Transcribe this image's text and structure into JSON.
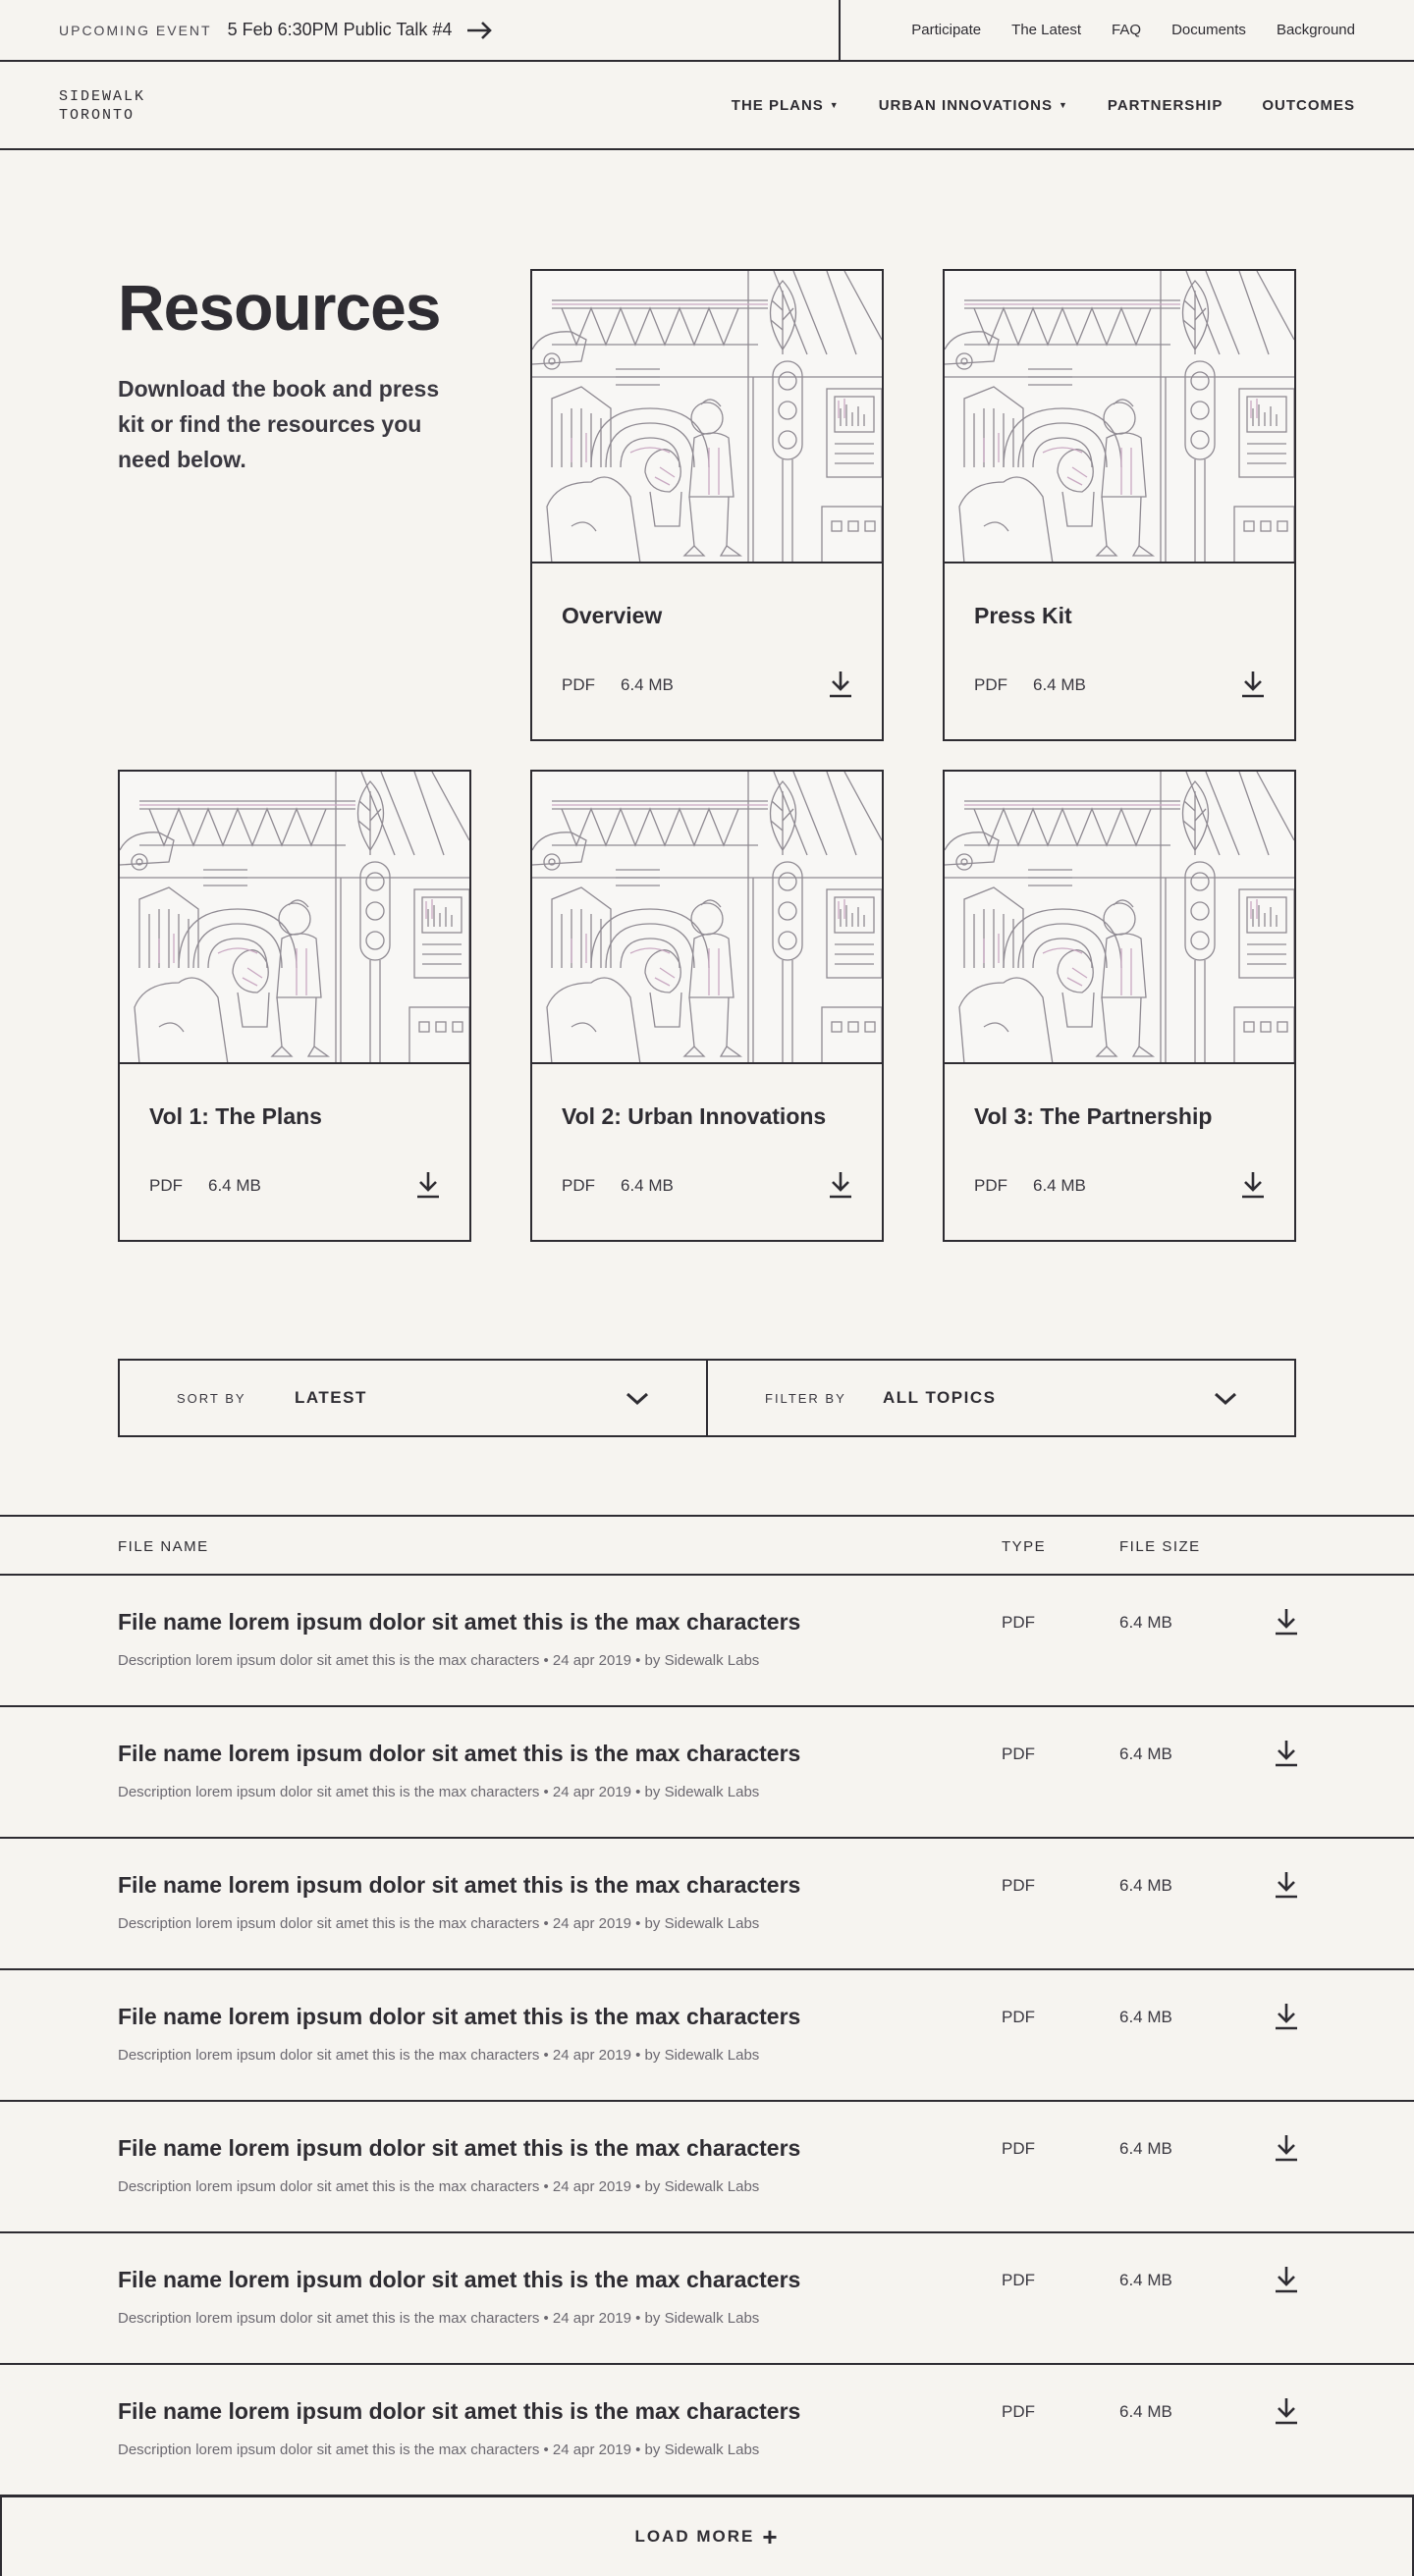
{
  "event_bar": {
    "kicker": "Upcoming Event",
    "title": "5 Feb 6:30PM Public Talk #4",
    "arrow_icon": "arrow-right-icon"
  },
  "utility_nav": [
    "Participate",
    "The Latest",
    "FAQ",
    "Documents",
    "Background"
  ],
  "logo": {
    "line1": "SIDEWALK",
    "line2": "TORONTO"
  },
  "main_nav": [
    {
      "label": "The Plans",
      "has_dropdown": true
    },
    {
      "label": "Urban Innovations",
      "has_dropdown": true
    },
    {
      "label": "Partnership",
      "has_dropdown": false
    },
    {
      "label": "Outcomes",
      "has_dropdown": false
    }
  ],
  "hero": {
    "title": "Resources",
    "subtitle": "Download the book and press kit or find the resources you need below."
  },
  "cards": [
    {
      "title": "Overview",
      "type": "PDF",
      "size": "6.4 MB"
    },
    {
      "title": "Press Kit",
      "type": "PDF",
      "size": "6.4 MB"
    },
    {
      "title": "Vol 1: The Plans",
      "type": "PDF",
      "size": "6.4 MB"
    },
    {
      "title": "Vol 2: Urban Innovations",
      "type": "PDF",
      "size": "6.4 MB"
    },
    {
      "title": "Vol 3: The Partnership",
      "type": "PDF",
      "size": "6.4 MB"
    }
  ],
  "controls": {
    "sort_label": "Sort by",
    "sort_value": "Latest",
    "filter_label": "Filter by",
    "filter_value": "All Topics"
  },
  "table": {
    "headers": {
      "name": "File Name",
      "type": "Type",
      "size": "File Size"
    },
    "rows": [
      {
        "title": "File name lorem ipsum dolor sit amet this is the max characters",
        "desc": "Description lorem ipsum dolor sit amet this is the max characters • 24 apr 2019 • by Sidewalk Labs",
        "type": "PDF",
        "size": "6.4 MB"
      },
      {
        "title": "File name lorem ipsum dolor sit amet this is the max characters",
        "desc": "Description lorem ipsum dolor sit amet this is the max characters • 24 apr 2019 • by Sidewalk Labs",
        "type": "PDF",
        "size": "6.4 MB"
      },
      {
        "title": "File name lorem ipsum dolor sit amet this is the max characters",
        "desc": "Description lorem ipsum dolor sit amet this is the max characters • 24 apr 2019 • by Sidewalk Labs",
        "type": "PDF",
        "size": "6.4 MB"
      },
      {
        "title": "File name lorem ipsum dolor sit amet this is the max characters",
        "desc": "Description lorem ipsum dolor sit amet this is the max characters • 24 apr 2019 • by Sidewalk Labs",
        "type": "PDF",
        "size": "6.4 MB"
      },
      {
        "title": "File name lorem ipsum dolor sit amet this is the max characters",
        "desc": "Description lorem ipsum dolor sit amet this is the max characters • 24 apr 2019 • by Sidewalk Labs",
        "type": "PDF",
        "size": "6.4 MB"
      },
      {
        "title": "File name lorem ipsum dolor sit amet this is the max characters",
        "desc": "Description lorem ipsum dolor sit amet this is the max characters • 24 apr 2019 • by Sidewalk Labs",
        "type": "PDF",
        "size": "6.4 MB"
      },
      {
        "title": "File name lorem ipsum dolor sit amet this is the max characters",
        "desc": "Description lorem ipsum dolor sit amet this is the max characters • 24 apr 2019 • by Sidewalk Labs",
        "type": "PDF",
        "size": "6.4 MB"
      }
    ]
  },
  "load_more": {
    "label": "Load More",
    "icon": "plus-icon"
  },
  "colors": {
    "ink": "#2e2c32",
    "background": "#f6f4f0",
    "accent_line": "#c9a9c2"
  }
}
